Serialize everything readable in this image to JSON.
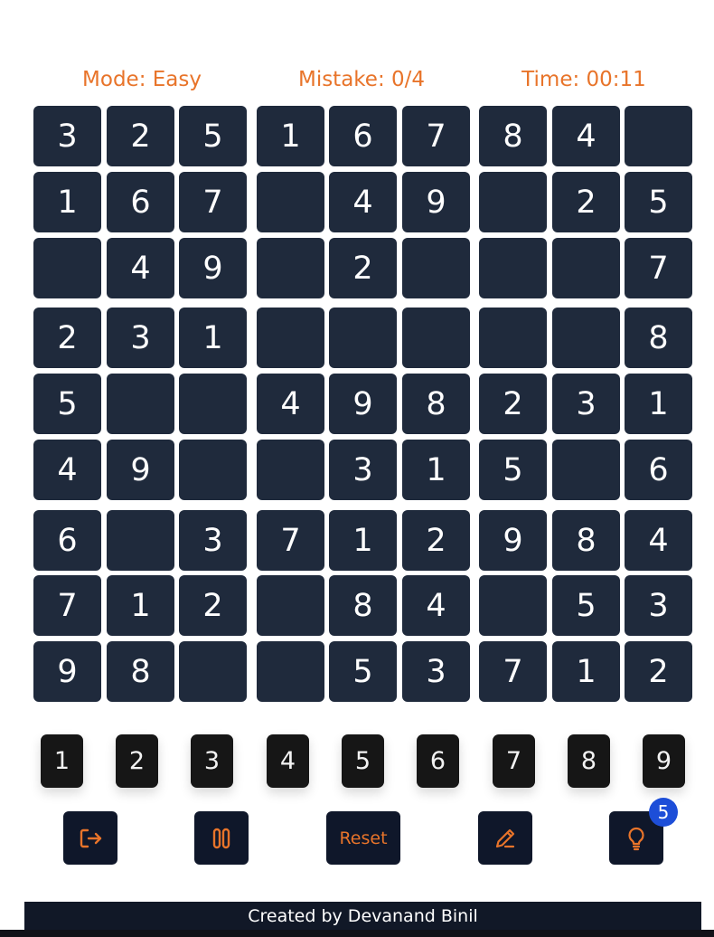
{
  "status": {
    "mode": "Mode: Easy",
    "mistake": "Mistake: 0/4",
    "time": "Time: 00:11"
  },
  "board": [
    [
      "3",
      "2",
      "5",
      "1",
      "6",
      "7",
      "8",
      "4",
      ""
    ],
    [
      "1",
      "6",
      "7",
      "",
      "4",
      "9",
      "",
      "2",
      "5"
    ],
    [
      "",
      "4",
      "9",
      "",
      "2",
      "",
      "",
      "",
      "7"
    ],
    [
      "2",
      "3",
      "1",
      "",
      "",
      "",
      "",
      "",
      "8"
    ],
    [
      "5",
      "",
      "",
      "4",
      "9",
      "8",
      "2",
      "3",
      "1"
    ],
    [
      "4",
      "9",
      "",
      "",
      "3",
      "1",
      "5",
      "",
      "6"
    ],
    [
      "6",
      "",
      "3",
      "7",
      "1",
      "2",
      "9",
      "8",
      "4"
    ],
    [
      "7",
      "1",
      "2",
      "",
      "8",
      "4",
      "",
      "5",
      "3"
    ],
    [
      "9",
      "8",
      "",
      "",
      "5",
      "3",
      "7",
      "1",
      "2"
    ]
  ],
  "number_pad": [
    "1",
    "2",
    "3",
    "4",
    "5",
    "6",
    "7",
    "8",
    "9"
  ],
  "controls": {
    "exit_icon": "exit-icon",
    "pause_icon": "pause-icon",
    "reset_label": "Reset",
    "pencil_icon": "pencil-icon",
    "hint_icon": "lightbulb-icon",
    "hint_count": "5"
  },
  "footer": "Created by Devanand Binil",
  "colors": {
    "accent": "#e8742a",
    "cell_bg": "#1f2a3c",
    "numpad_bg": "#161616",
    "control_bg": "#0f172a",
    "badge_bg": "#1d4ed8",
    "footer_bg": "#111827"
  }
}
